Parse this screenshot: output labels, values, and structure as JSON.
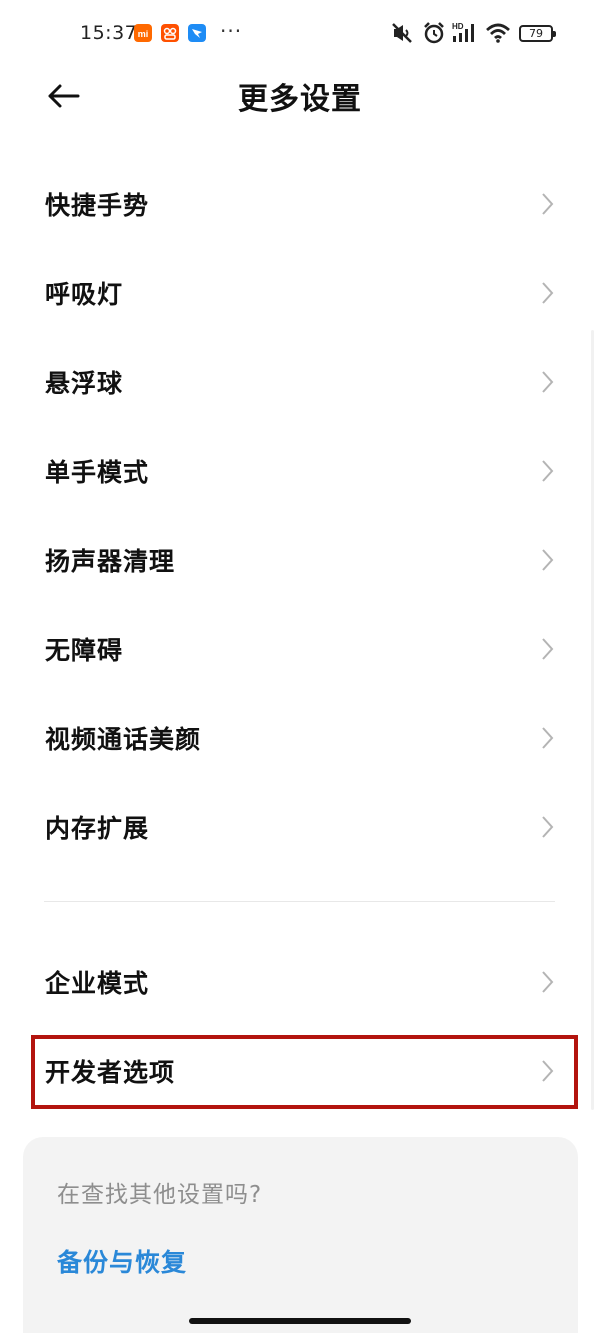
{
  "status_bar": {
    "time": "15:37",
    "more_indicator": "···",
    "battery": "79",
    "network_label": "HD",
    "icons": [
      "xiaomi-app-icon",
      "taobao-app-icon",
      "dingtalk-app-icon",
      "mute-icon",
      "alarm-icon",
      "signal-icon",
      "wifi-icon",
      "battery-icon"
    ]
  },
  "header": {
    "title": "更多设置",
    "back_icon": "arrow-left-icon"
  },
  "settings": {
    "group1": [
      {
        "label": "快捷手势"
      },
      {
        "label": "呼吸灯"
      },
      {
        "label": "悬浮球"
      },
      {
        "label": "单手模式"
      },
      {
        "label": "扬声器清理"
      },
      {
        "label": "无障碍"
      },
      {
        "label": "视频通话美颜"
      },
      {
        "label": "内存扩展"
      }
    ],
    "group2": [
      {
        "label": "企业模式"
      },
      {
        "label": "开发者选项"
      }
    ],
    "chevron_icon": "chevron-right-icon"
  },
  "suggest": {
    "title": "在查找其他设置吗?",
    "link": "备份与恢复"
  },
  "colors": {
    "accent": "#2a88d8",
    "highlight": "#b3140e",
    "card_bg": "#f3f3f3",
    "xiaomi_orange": "#ff6900",
    "taobao_orange": "#ff5000",
    "dingtalk_blue": "#1e8cf5"
  }
}
